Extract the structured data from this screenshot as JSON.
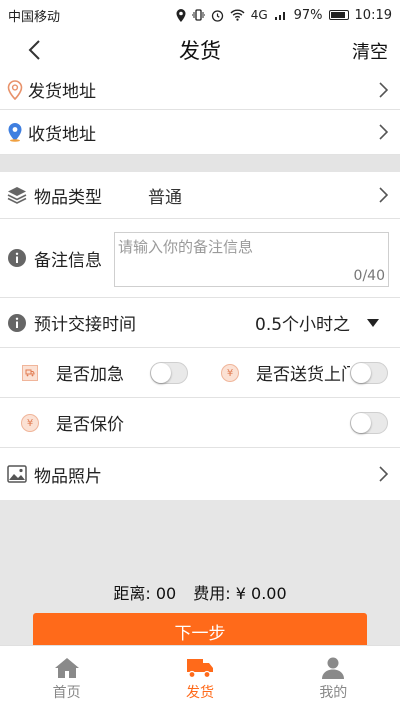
{
  "status_bar": {
    "carrier": "中国移动",
    "battery": "97%",
    "time": "10:19",
    "net": "4G"
  },
  "nav": {
    "title": "发货",
    "clear": "清空"
  },
  "send_address": {
    "label": "发货地址"
  },
  "receive_address": {
    "label": "收货地址"
  },
  "item_type": {
    "label": "物品类型",
    "value": "普通"
  },
  "remark": {
    "label": "备注信息",
    "placeholder": "请输入你的备注信息",
    "count": "0/40"
  },
  "handover_time": {
    "label": "预计交接时间",
    "value": "0.5个小时之"
  },
  "urgent": {
    "label": "是否加急",
    "on": false
  },
  "door_delivery": {
    "label": "是否送货上门",
    "on": false
  },
  "insured": {
    "label": "是否保价",
    "on": false
  },
  "photos": {
    "label": "物品照片"
  },
  "summary": {
    "distance": "距离: 00",
    "fee": "费用: ¥ 0.00"
  },
  "next_button": {
    "label": "下一步"
  },
  "tabs": [
    {
      "label": "首页",
      "icon": "home-icon",
      "active": false
    },
    {
      "label": "发货",
      "icon": "truck-icon",
      "active": true
    },
    {
      "label": "我的",
      "icon": "user-icon",
      "active": false
    }
  ],
  "colors": {
    "accent": "#ff6a1a",
    "divider": "#e2e2e2",
    "gap": "#e4e4e4"
  }
}
